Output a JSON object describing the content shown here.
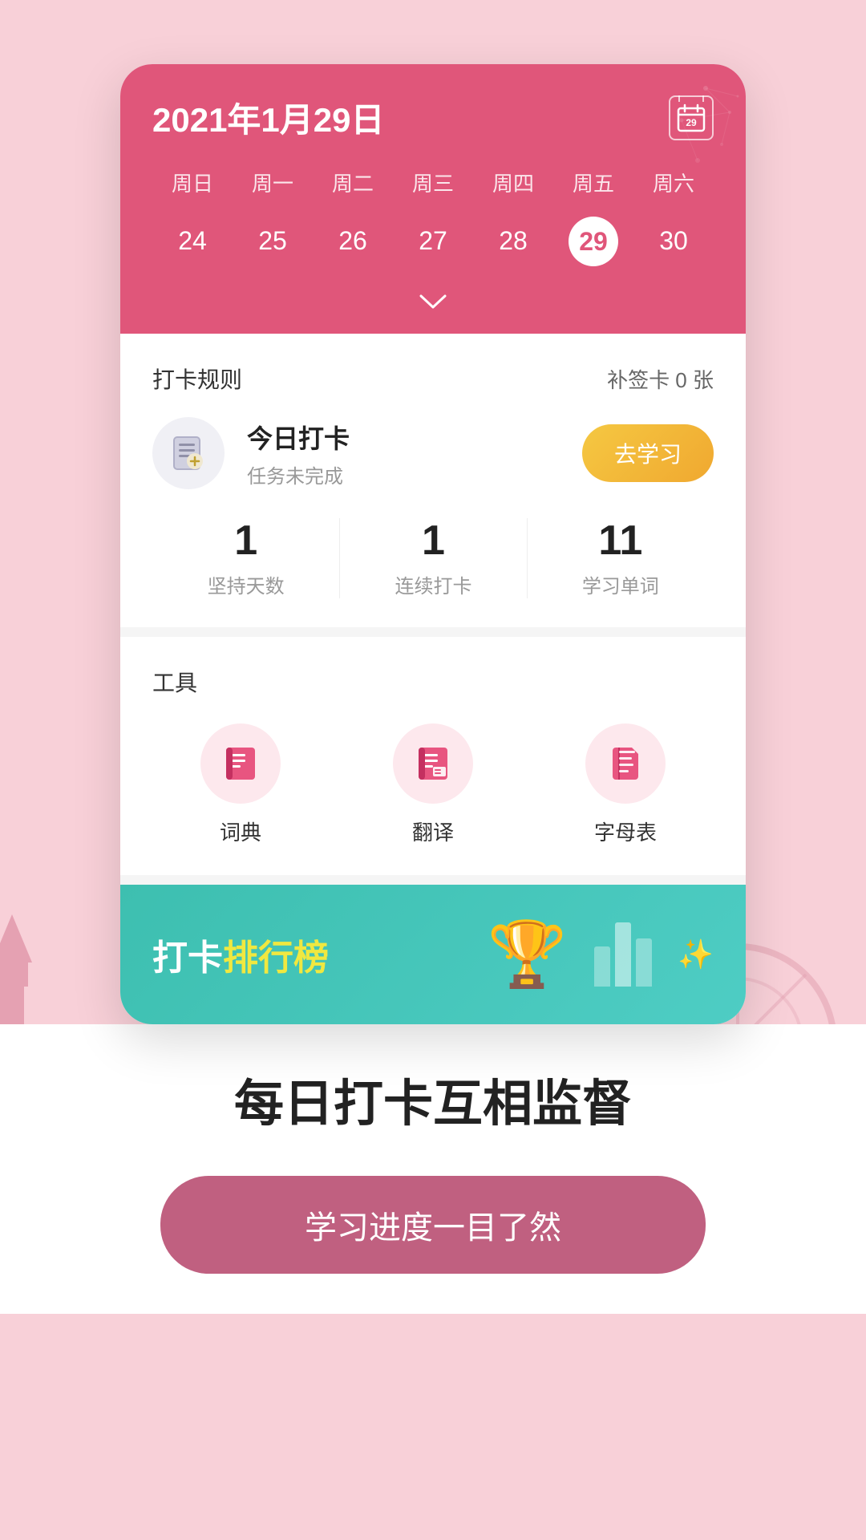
{
  "calendar": {
    "title": "2021年1月29日",
    "icon_number": "29",
    "weekdays": [
      "周日",
      "周一",
      "周二",
      "周三",
      "周四",
      "周五",
      "周六"
    ],
    "dates": [
      "24",
      "25",
      "26",
      "27",
      "28",
      "29",
      "30"
    ],
    "selected_date": "29",
    "chevron": "∨"
  },
  "checkin": {
    "section_label": "打卡规则",
    "supplement_label": "补签卡 0 张",
    "today_label": "今日打卡",
    "task_status": "任务未完成",
    "btn_study": "去学习"
  },
  "stats": [
    {
      "number": "1",
      "label": "坚持天数"
    },
    {
      "number": "1",
      "label": "连续打卡"
    },
    {
      "number": "11",
      "label": "学习单词"
    }
  ],
  "tools": {
    "section_label": "工具",
    "items": [
      {
        "name": "词典",
        "icon": "dictionary"
      },
      {
        "name": "翻译",
        "icon": "translate"
      },
      {
        "name": "字母表",
        "icon": "alphabet"
      }
    ]
  },
  "ranking": {
    "text_prefix": "打卡",
    "text_highlight": "排行榜"
  },
  "bottom": {
    "tagline": "每日打卡互相监督",
    "cta": "学习进度一目了然"
  }
}
